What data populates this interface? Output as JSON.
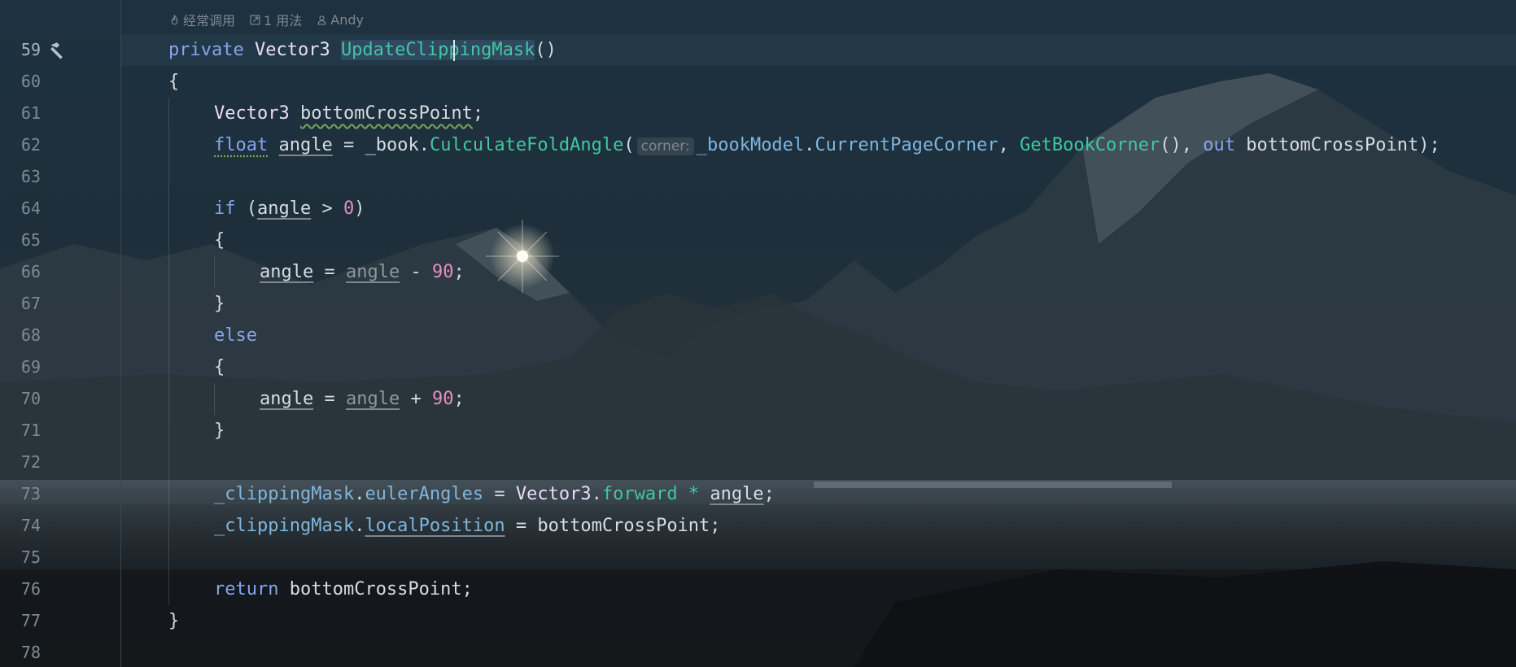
{
  "inlay_header": {
    "usage_hint": "经常调用",
    "usages": "1 用法",
    "author": "Andy"
  },
  "line_numbers": [
    "59",
    "60",
    "61",
    "62",
    "63",
    "64",
    "65",
    "66",
    "67",
    "68",
    "69",
    "70",
    "71",
    "72",
    "73",
    "74",
    "75",
    "76",
    "77",
    "78"
  ],
  "code": {
    "l59": {
      "kw_private": "private",
      "type": "Vector3",
      "fn_name": "UpdateClippingMask",
      "parens": "()"
    },
    "l60": {
      "brace": "{"
    },
    "l61": {
      "type": "Vector3",
      "var": "bottomCrossPoint",
      "semi": ";"
    },
    "l62": {
      "kw_float": "float",
      "var": "angle",
      "eq": " = ",
      "field_book": "_book",
      "dot1": ".",
      "method": "CulculateFoldAngle",
      "open": "(",
      "param_hint": "corner:",
      "field_model": "_bookModel",
      "dot2": ".",
      "field_corner": "CurrentPageCorner",
      "comma1": ", ",
      "method2": "GetBookCorner",
      "call2": "()",
      "comma2": ", ",
      "kw_out": "out",
      "out_var": " bottomCrossPoint",
      "close": ");"
    },
    "l64": {
      "kw_if": "if",
      "open": " (",
      "var": "angle",
      "op": " > ",
      "num": "0",
      "close": ")"
    },
    "l65": {
      "brace": "{"
    },
    "l66": {
      "var": "angle",
      "eq": " = ",
      "var2": "angle",
      "op": " - ",
      "num": "90",
      "semi": ";"
    },
    "l67": {
      "brace": "}"
    },
    "l68": {
      "kw_else": "else"
    },
    "l69": {
      "brace": "{"
    },
    "l70": {
      "var": "angle",
      "eq": " = ",
      "var2": "angle",
      "op": " + ",
      "num": "90",
      "semi": ";"
    },
    "l71": {
      "brace": "}"
    },
    "l73": {
      "field_mask": "_clippingMask",
      "dot1": ".",
      "field_euler": "eulerAngles",
      "eq": " = ",
      "type": "Vector3",
      "dot2": ".",
      "field_forward": "forward",
      "star": " * ",
      "var": "angle",
      "semi": ";"
    },
    "l74": {
      "field_mask": "_clippingMask",
      "dot1": ".",
      "field_local": "localPosition",
      "eq": " = ",
      "var": "bottomCrossPoint",
      "semi": ";"
    },
    "l76": {
      "kw_return": "return",
      "var": " bottomCrossPoint",
      "semi": ";"
    },
    "l77": {
      "brace": "}"
    }
  },
  "icons": {
    "gutter": "hammer-icon",
    "inlay_usage": "flame-icon",
    "inlay_usages": "external-link-icon",
    "inlay_author": "person-icon"
  },
  "colors": {
    "keyword": "#87a4ec",
    "type": "#eadcfa",
    "method": "#42c7a0",
    "field": "#7fb6de",
    "number": "#e38ec0"
  }
}
